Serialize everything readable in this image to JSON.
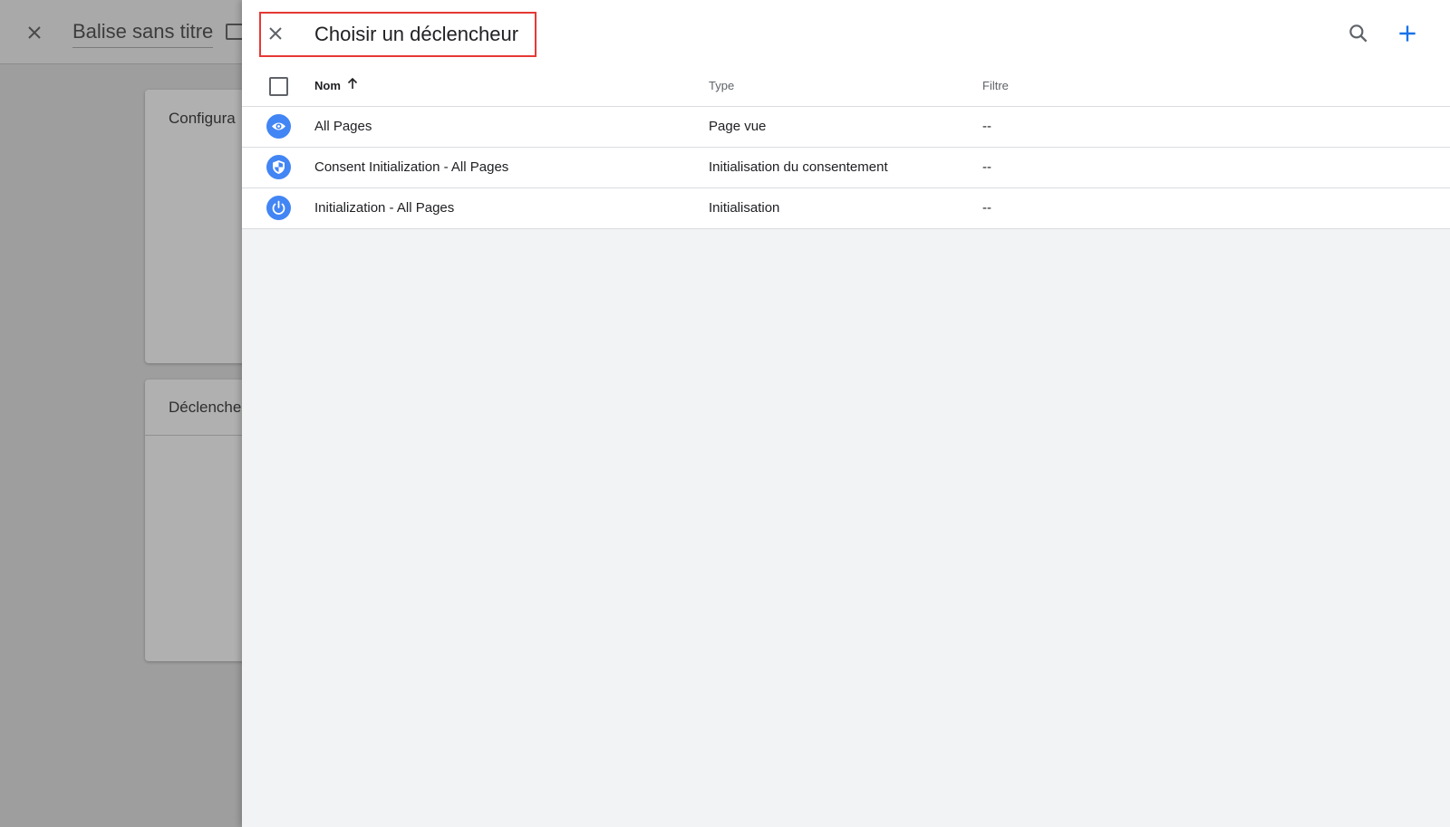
{
  "background": {
    "title": "Balise sans titre",
    "card_config_label": "Configura",
    "card_trigger_label": "Déclenche"
  },
  "panel": {
    "title": "Choisir un déclencheur",
    "accent_color": "#1a73e8",
    "highlight_color": "#e53935",
    "columns": {
      "name": "Nom",
      "type": "Type",
      "filter": "Filtre"
    },
    "sort_direction": "ascending",
    "rows": [
      {
        "icon": "eye-icon",
        "name": "All Pages",
        "type": "Page vue",
        "filter": "--"
      },
      {
        "icon": "shield-icon",
        "name": "Consent Initialization - All Pages",
        "type": "Initialisation du consentement",
        "filter": "--"
      },
      {
        "icon": "power-icon",
        "name": "Initialization - All Pages",
        "type": "Initialisation",
        "filter": "--"
      }
    ]
  }
}
